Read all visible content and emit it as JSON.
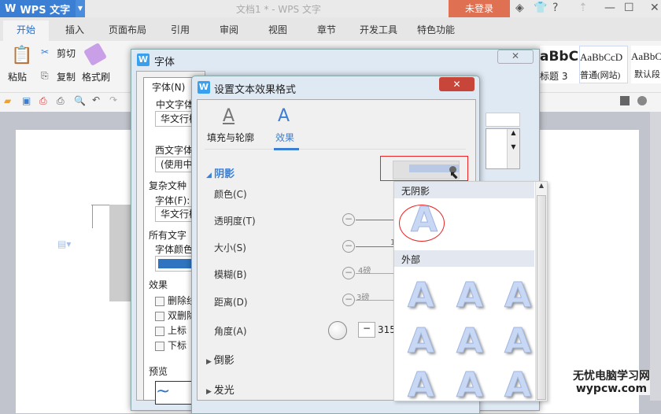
{
  "app": {
    "name": "WPS 文字",
    "doc_title": "文档1 * - WPS 文字",
    "login": "未登录",
    "help": "?"
  },
  "tabs": [
    "开始",
    "插入",
    "页面布局",
    "引用",
    "审阅",
    "视图",
    "章节",
    "开发工具",
    "特色功能"
  ],
  "ribbon": {
    "paste": "粘贴",
    "cut": "剪切",
    "copy": "复制",
    "format_painter": "格式刷",
    "styles": [
      {
        "preview": "aBbC",
        "name": "标题 3"
      },
      {
        "preview": "AaBbCcD",
        "name": "普通(网站)"
      },
      {
        "preview": "AaBbC",
        "name": "默认段"
      }
    ]
  },
  "font_dialog": {
    "title": "字体",
    "tab": "字体(N)",
    "cn_font_label": "中文字体",
    "cn_font_value": "华文行楷",
    "west_font_label": "西文字体",
    "west_font_value": "(使用中",
    "complex_label": "复杂文种",
    "complex_font_label": "字体(F):",
    "complex_font_value": "华文行楷",
    "all_text_label": "所有文字",
    "font_color_label": "字体颜色",
    "effects_label": "效果",
    "checks": [
      "删除线",
      "双删除",
      "上标",
      "下标"
    ],
    "preview_label": "预览",
    "font_color": "#2f74c0"
  },
  "effect_dialog": {
    "title": "设置文本效果格式",
    "tab_fill": "填充与轮廓",
    "tab_effect": "效果",
    "shadow": "阴影",
    "rows": [
      "颜色(C)",
      "透明度(T)",
      "大小(S)",
      "模糊(B)",
      "距离(D)",
      "角度(A)"
    ],
    "blur_value": "4磅",
    "distance_value": "3磅",
    "size_value": "1",
    "angle_value": "315",
    "reflection": "倒影",
    "glow": "发光"
  },
  "shadow_menu": {
    "none": "无阴影",
    "outer": "外部"
  },
  "watermark": {
    "line1": "无忧电脑学习网",
    "line2": "wypcw.com"
  }
}
